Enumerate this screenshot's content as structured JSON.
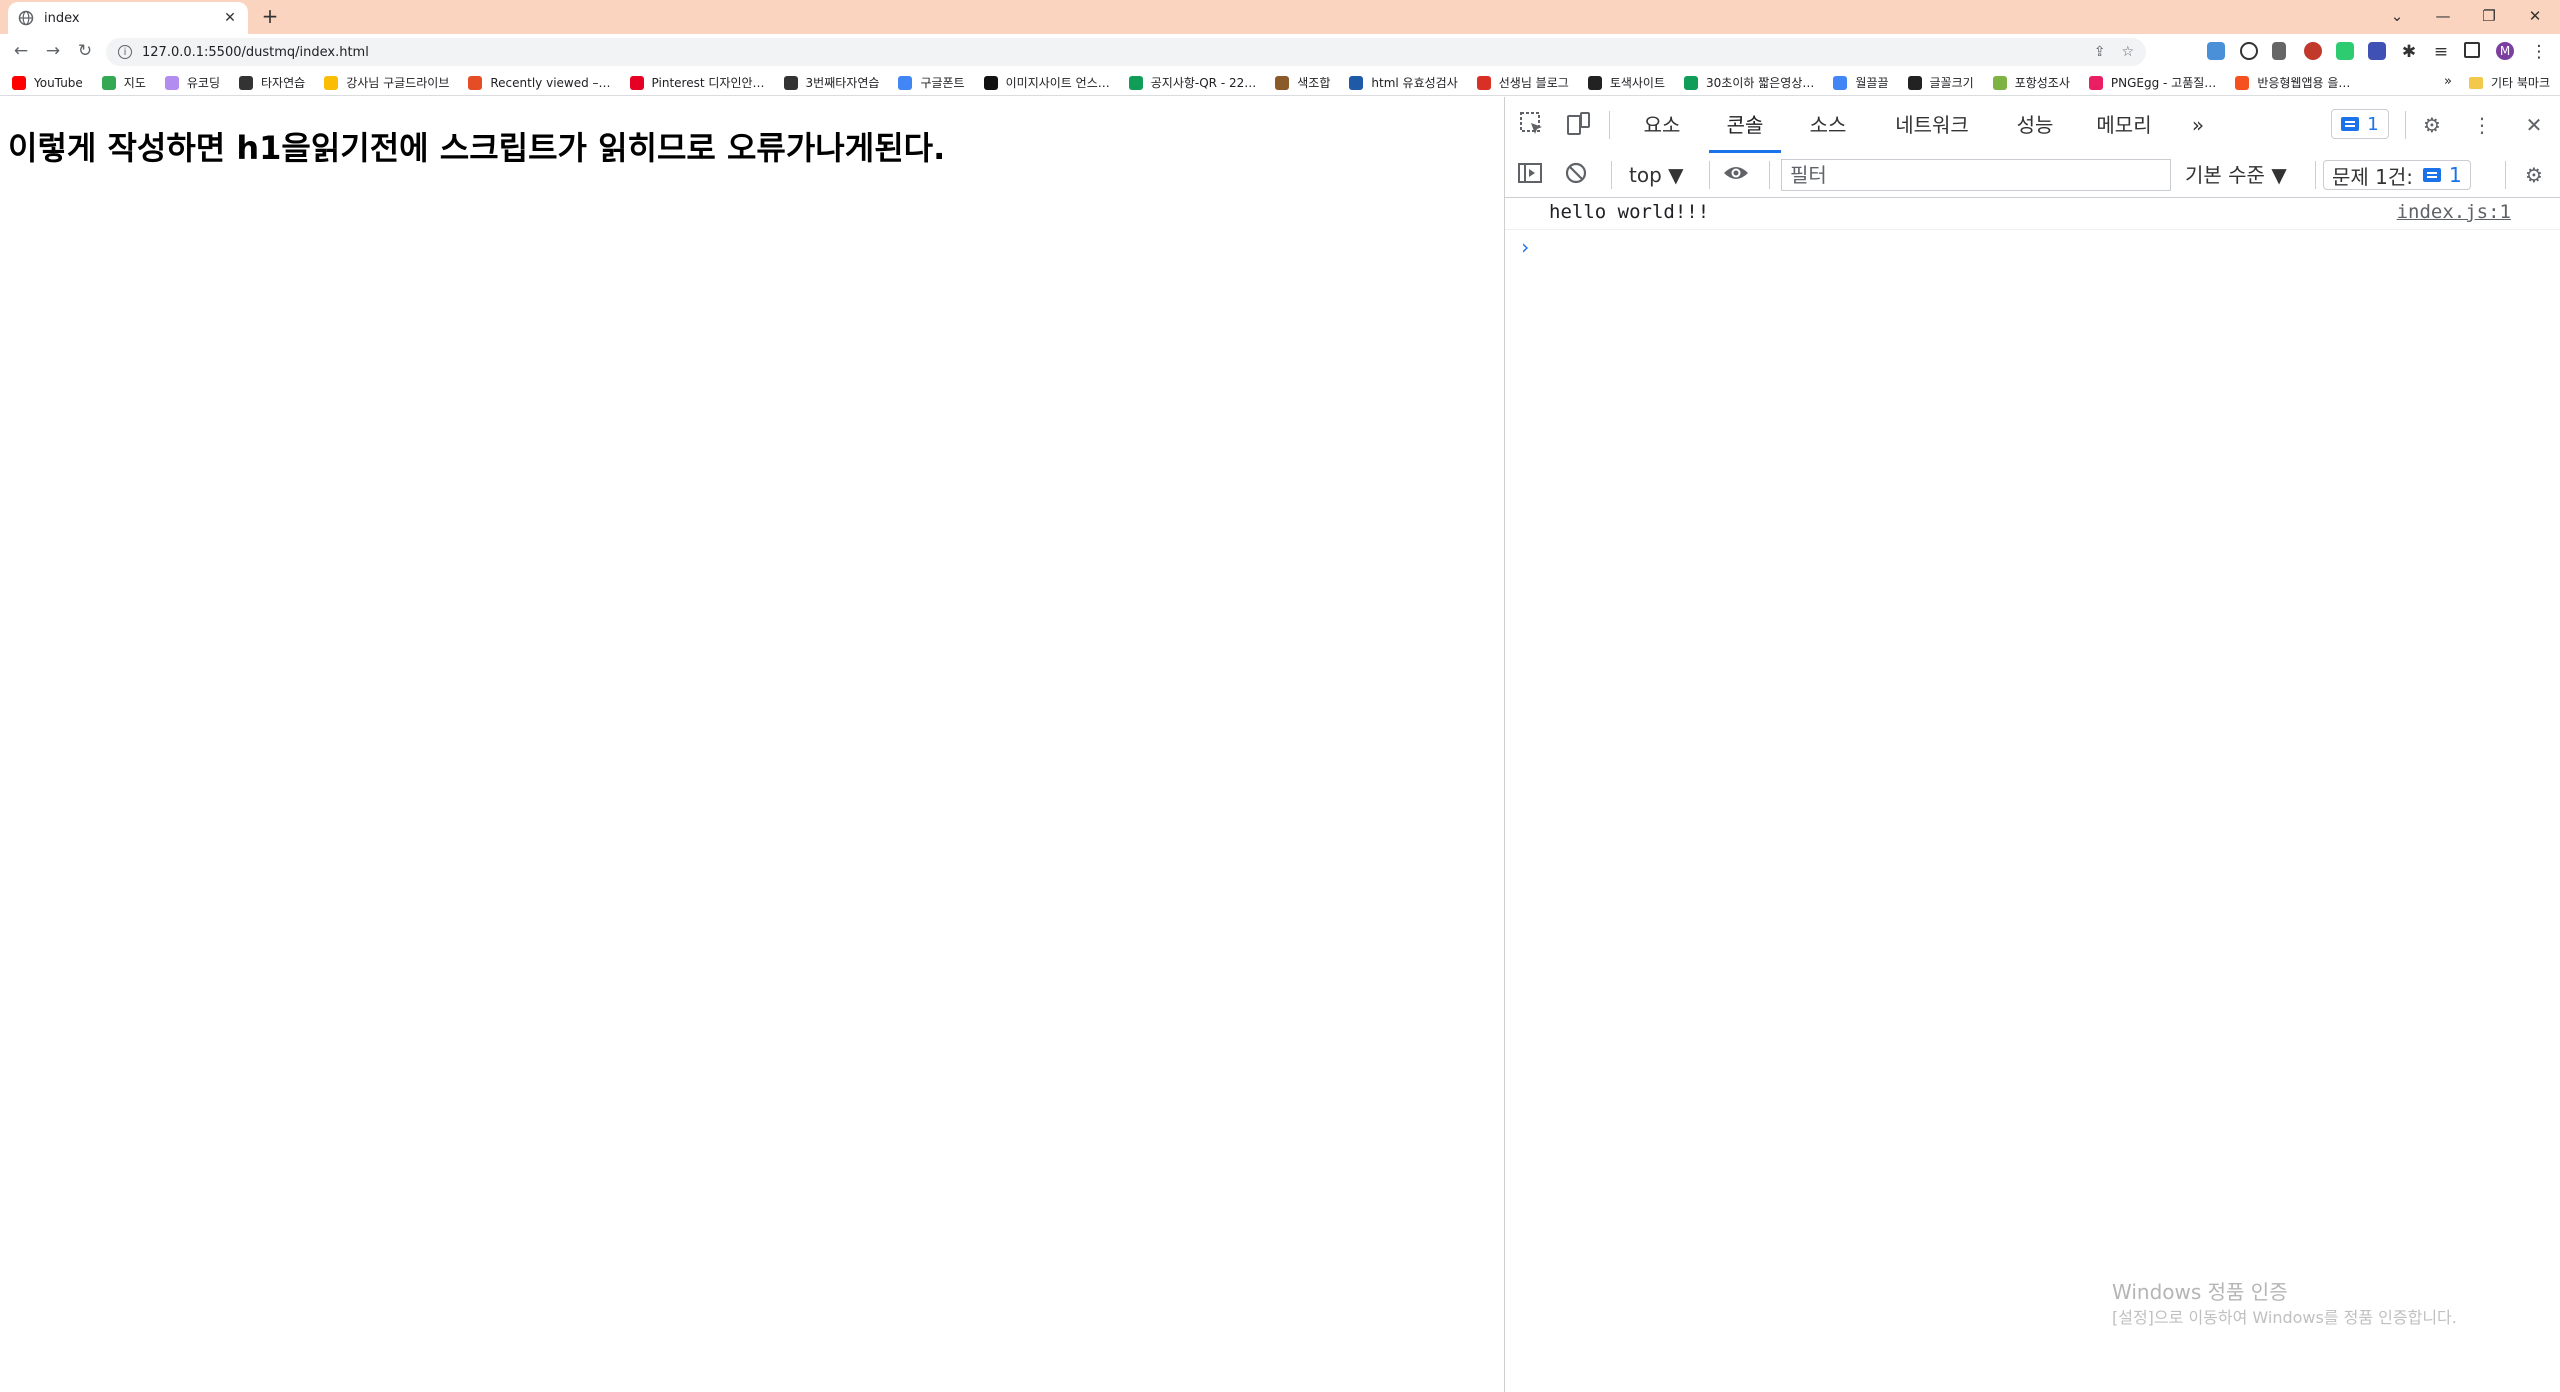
{
  "browser": {
    "tab_title": "index",
    "url": "127.0.0.1:5500/dustmq/index.html",
    "new_tab_glyph": "+",
    "tab_close_glyph": "✕",
    "window_buttons": [
      "⌄",
      "—",
      "❐",
      "✕"
    ]
  },
  "bookmarks": [
    {
      "label": "YouTube",
      "color": "#ff0000"
    },
    {
      "label": "지도",
      "color": "#34a853"
    },
    {
      "label": "유코딩",
      "color": "#b38cf0"
    },
    {
      "label": "타자연습",
      "color": "#333333"
    },
    {
      "label": "강사님 구글드라이브",
      "color": "#fbbc04"
    },
    {
      "label": "Recently viewed –…",
      "color": "#e44d26"
    },
    {
      "label": "Pinterest 디자인안…",
      "color": "#e60023"
    },
    {
      "label": "3번째타자연습",
      "color": "#333333"
    },
    {
      "label": "구글폰트",
      "color": "#4285f4"
    },
    {
      "label": "이미지사이트 언스…",
      "color": "#111111"
    },
    {
      "label": "공지사항-QR - 22…",
      "color": "#0f9d58"
    },
    {
      "label": "색조합",
      "color": "#8b5a2b"
    },
    {
      "label": "html 유효성검사",
      "color": "#1e5aa8"
    },
    {
      "label": "선생님 블로그",
      "color": "#d93025"
    },
    {
      "label": "토색사이트",
      "color": "#222222"
    },
    {
      "label": "30초이하 짧은영상…",
      "color": "#0f9d58"
    },
    {
      "label": "월끌끌",
      "color": "#4285f4"
    },
    {
      "label": "글꼴크기",
      "color": "#222222"
    },
    {
      "label": "포항성조사",
      "color": "#7cb342"
    },
    {
      "label": "PNGEgg - 고품질…",
      "color": "#e91e63"
    },
    {
      "label": "반응형웹앱용 을…",
      "color": "#f4511e"
    }
  ],
  "bookmarks_more": "»",
  "bookmarks_other": "기타 북마크",
  "page": {
    "heading": "이렇게 작성하면 h1을읽기전에 스크립트가 읽히므로 오류가나게된다."
  },
  "devtools": {
    "tabs": [
      "요소",
      "콘솔",
      "소스",
      "네트워크",
      "성능",
      "메모리"
    ],
    "more_tabs": "»",
    "issues_count": "1",
    "context": "top ▼",
    "filter_placeholder": "필터",
    "log_level": "기본 수준 ▼",
    "issues_label": "문제 1건:",
    "issues_count2": "1",
    "console_message": "hello world!!!",
    "console_source": "index.js:1",
    "prompt": "›"
  },
  "watermark": {
    "line1": "Windows 정품 인증",
    "line2": "[설정]으로 이동하여 Windows를 정품 인증합니다."
  }
}
